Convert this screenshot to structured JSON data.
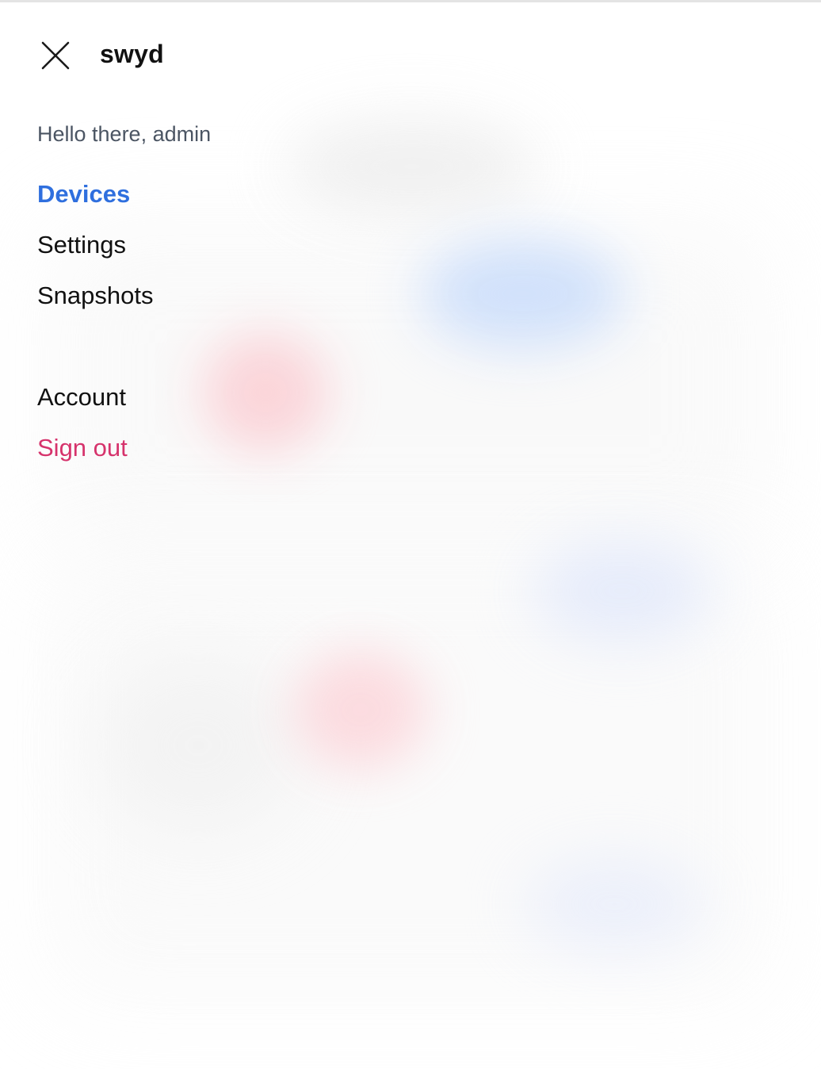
{
  "app": {
    "title": "swyd"
  },
  "menu": {
    "close_icon": "close-icon",
    "greeting": "Hello there, admin",
    "items": [
      {
        "label": "Devices",
        "active": true
      },
      {
        "label": "Settings",
        "active": false
      },
      {
        "label": "Snapshots",
        "active": false
      }
    ],
    "account_items": [
      {
        "label": "Account"
      },
      {
        "label": "Sign out"
      }
    ]
  },
  "colors": {
    "active_link": "#2f6fde",
    "signout": "#d6336c",
    "greeting_text": "#4b5563"
  }
}
